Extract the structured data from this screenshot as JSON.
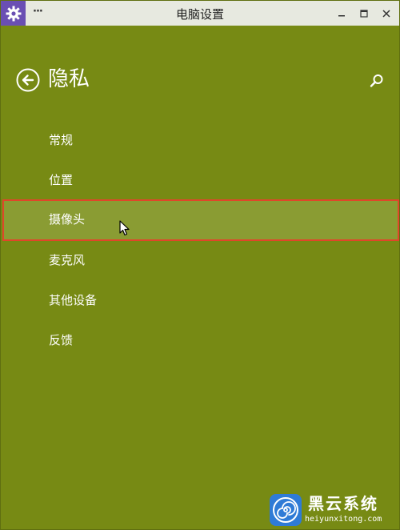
{
  "window": {
    "title": "电脑设置",
    "menu_label": "···"
  },
  "header": {
    "title": "隐私"
  },
  "nav": {
    "items": [
      {
        "label": "常规"
      },
      {
        "label": "位置"
      },
      {
        "label": "摄像头"
      },
      {
        "label": "麦克风"
      },
      {
        "label": "其他设备"
      },
      {
        "label": "反馈"
      }
    ],
    "selected_index": 2
  },
  "watermark": {
    "name": "黑云系统",
    "url": "heiyunxitong.com"
  },
  "colors": {
    "background": "#778a14",
    "titlebar": "#e7e9e0",
    "selected_bg": "#8a9c33",
    "selected_border": "#e0462a",
    "app_icon_bg": "#6a4fb3"
  },
  "icons": {
    "app": "gear-icon",
    "back": "back-arrow-circle-icon",
    "search": "search-icon",
    "minimize": "minimize-icon",
    "maximize": "maximize-icon",
    "close": "close-icon"
  }
}
